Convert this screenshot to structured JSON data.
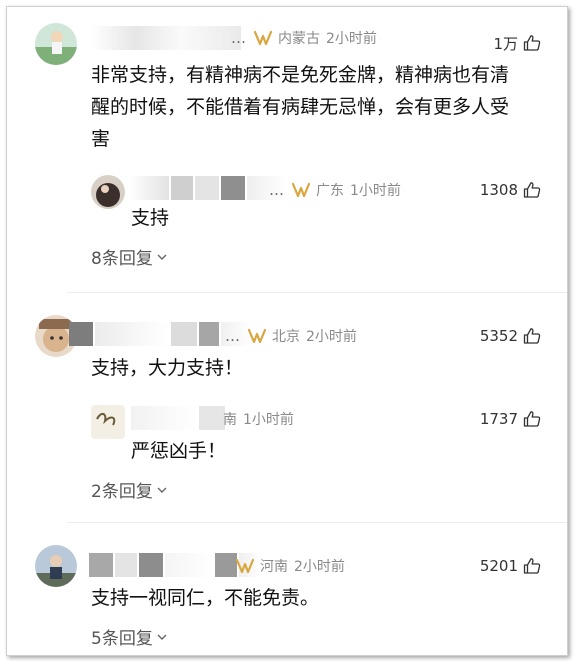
{
  "comments": [
    {
      "name_tail": "…",
      "location": "内蒙古",
      "time": "2小时前",
      "likes": "1万",
      "text_lines": [
        "非常支持，有精神病不是免死金牌，精神病也有清",
        "醒的时候，不能借着有病肆无忌惮，会有更多人受",
        "害"
      ],
      "reply": {
        "name_tail": "…",
        "location": "广东",
        "time": "1小时前",
        "likes": "1308",
        "text": "支持"
      },
      "more_replies": "8条回复"
    },
    {
      "name_tail": "…",
      "location": "北京",
      "time": "2小时前",
      "likes": "5352",
      "text_lines": [
        "支持，大力支持！"
      ],
      "reply": {
        "name_tail": "南",
        "location": "",
        "time": "1小时前",
        "likes": "1737",
        "text": "严惩凶手！"
      },
      "more_replies": "2条回复"
    },
    {
      "name_tail": "",
      "location": "河南",
      "time": "2小时前",
      "likes": "5201",
      "text_lines": [
        "支持一视同仁，不能免责。"
      ],
      "more_replies": "5条回复"
    }
  ],
  "icons": {
    "vip": "vip-badge-icon",
    "like": "thumbs-up-icon",
    "expand": "chevron-down-icon"
  },
  "colors": {
    "vip_gold": "#d9a640",
    "meta_gray": "#8a8a8a"
  }
}
